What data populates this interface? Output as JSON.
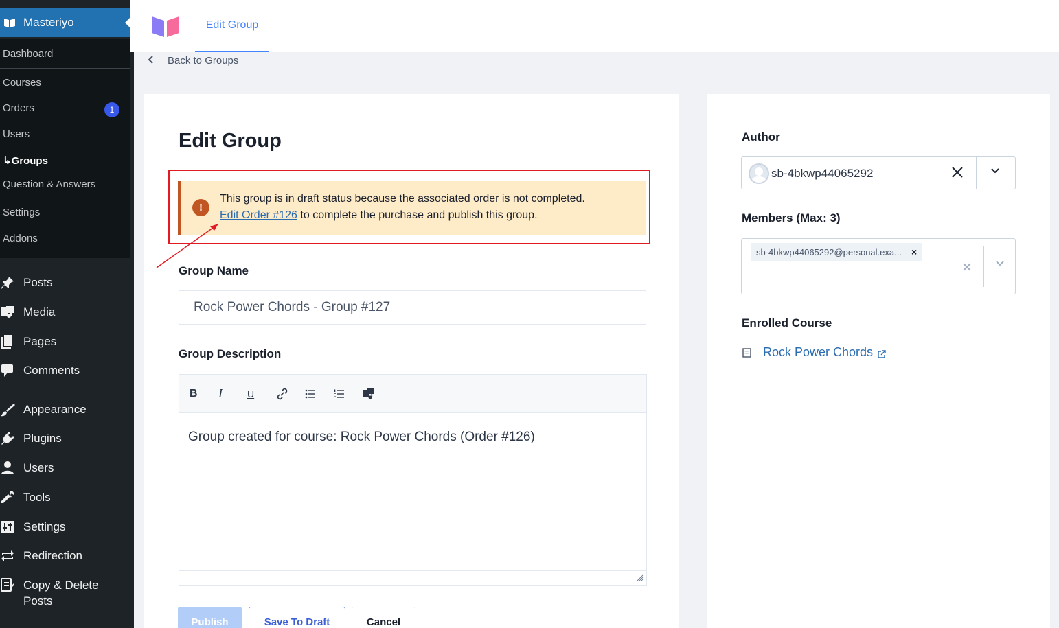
{
  "sidebar": {
    "masteriyo_label": "Masteriyo",
    "submenu": [
      {
        "label": "Dashboard"
      },
      {
        "label": "Courses"
      },
      {
        "label": "Orders"
      },
      {
        "label": "Users"
      },
      {
        "label": "Groups"
      },
      {
        "label": "Question & Answers"
      },
      {
        "label": "Settings"
      },
      {
        "label": "Addons"
      }
    ],
    "orders_badge": "1",
    "menu": [
      {
        "label": "Posts",
        "icon": "pushpin-icon"
      },
      {
        "label": "Media",
        "icon": "media-icon"
      },
      {
        "label": "Pages",
        "icon": "pages-icon"
      },
      {
        "label": "Comments",
        "icon": "comment-icon"
      },
      {
        "label": "Appearance",
        "icon": "paintbrush-icon"
      },
      {
        "label": "Plugins",
        "icon": "plug-icon"
      },
      {
        "label": "Users",
        "icon": "user-icon"
      },
      {
        "label": "Tools",
        "icon": "wrench-icon"
      },
      {
        "label": "Settings",
        "icon": "settings-icon"
      },
      {
        "label": "Redirection",
        "icon": "redirect-icon"
      },
      {
        "label": "Copy & Delete",
        "label2": "Posts",
        "icon": "copy-icon"
      }
    ]
  },
  "header": {
    "tab_label": "Edit Group"
  },
  "back_link": "Back to Groups",
  "main": {
    "title": "Edit Group",
    "alert": {
      "line1": "This group is in draft status because the associated order is not completed.",
      "link": "Edit Order #126",
      "line2_rest": " to complete the purchase and publish this group."
    },
    "group_name_label": "Group Name",
    "group_name_value": "Rock Power Chords - Group #127",
    "group_description_label": "Group Description",
    "editor_toolbar": {
      "bold": "B",
      "italic": "I",
      "underline": "U"
    },
    "description_text": "Group created for course: Rock Power Chords (Order #126)",
    "buttons": {
      "publish": "Publish",
      "save_draft": "Save To Draft",
      "cancel": "Cancel"
    }
  },
  "side": {
    "author_label": "Author",
    "author_value": "sb-4bkwp44065292",
    "members_label": "Members (Max: 3)",
    "member_tag": "sb-4bkwp44065292@personal.exa...",
    "enrolled_label": "Enrolled Course",
    "enrolled_course": "Rock Power Chords"
  },
  "colors": {
    "wp_sidebar": "#1d2327",
    "accent": "#4584ff",
    "alert_bg": "#feebc8",
    "alert_border": "#c05621",
    "highlight": "#e01b24"
  }
}
